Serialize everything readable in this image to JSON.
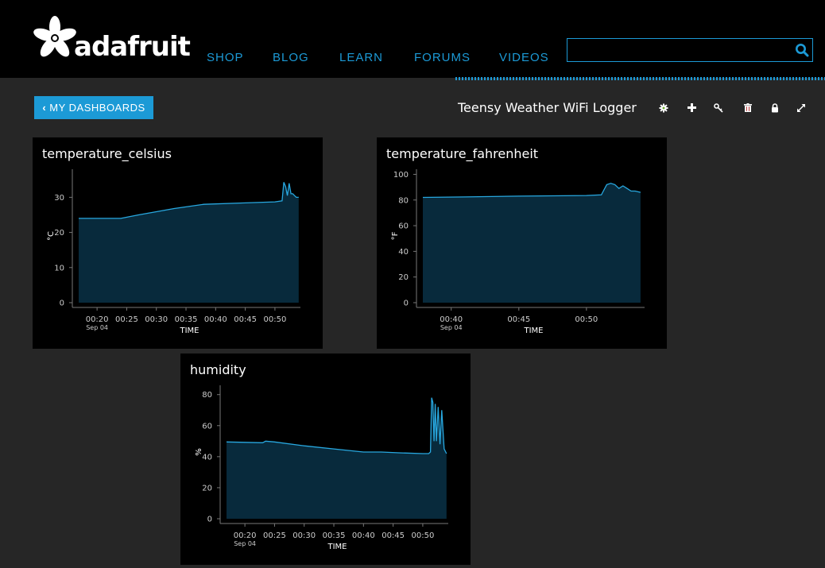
{
  "brand": {
    "name": "adafruit"
  },
  "nav": [
    "SHOP",
    "BLOG",
    "LEARN",
    "FORUMS",
    "VIDEOS"
  ],
  "search": {
    "value": "",
    "placeholder": ""
  },
  "dashboard": {
    "back_label": "MY DASHBOARDS",
    "title": "Teensy Weather WiFi Logger",
    "toolbar": [
      {
        "icon": "gear-icon",
        "color": "#6aad2c"
      },
      {
        "icon": "plus-icon",
        "color": "#1c9ad6"
      },
      {
        "icon": "key-icon",
        "color": "#a5a73c"
      },
      {
        "icon": "trash-icon",
        "color": "#b6393a"
      },
      {
        "icon": "lock-icon",
        "color": "#555555"
      },
      {
        "icon": "expand-icon",
        "color": "#555555"
      }
    ]
  },
  "colors": {
    "accent": "#1c9ad6",
    "line": "#28a8e0",
    "fill": "#082a3c"
  },
  "chart_data": [
    {
      "type": "area",
      "title": "temperature_celsius",
      "xlabel": "TIME",
      "ylabel": "°C",
      "date_label": "Sep 04",
      "ylim": [
        0,
        38
      ],
      "yticks": [
        0,
        10,
        20,
        30
      ],
      "xlim": [
        16.9,
        54.3
      ],
      "xticks": [
        20,
        25,
        30,
        35,
        40,
        45,
        50
      ],
      "xtick_labels": [
        "00:20",
        "00:25",
        "00:30",
        "00:35",
        "00:40",
        "00:45",
        "00:50"
      ],
      "x": [
        16.9,
        24.0,
        27.0,
        33.0,
        38.0,
        45.0,
        50.0,
        51.2,
        51.5,
        51.8,
        52.1,
        52.4,
        52.7,
        53.0,
        53.3,
        53.6,
        54.0
      ],
      "y": [
        24,
        24,
        25,
        26.8,
        28,
        28.4,
        28.7,
        29,
        34.3,
        33,
        30.5,
        34,
        31,
        31,
        30.5,
        30,
        30
      ]
    },
    {
      "type": "area",
      "title": "temperature_fahrenheit",
      "xlabel": "TIME",
      "ylabel": "°F",
      "date_label": "Sep 04",
      "ylim": [
        0,
        104
      ],
      "yticks": [
        0,
        20,
        40,
        60,
        80,
        100
      ],
      "xlim": [
        37.9,
        54.3
      ],
      "xticks": [
        40,
        45,
        50
      ],
      "xtick_labels": [
        "00:40",
        "00:45",
        "00:50"
      ],
      "x": [
        37.9,
        41.0,
        45.0,
        50.0,
        51.1,
        51.5,
        51.8,
        52.1,
        52.4,
        52.7,
        53.0,
        53.3,
        53.6,
        54.0
      ],
      "y": [
        82,
        82.4,
        83,
        83.5,
        84,
        92,
        93,
        92,
        89,
        91,
        89,
        87,
        87,
        86
      ]
    },
    {
      "type": "area",
      "title": "humidity",
      "xlabel": "TIME",
      "ylabel": "%",
      "date_label": "Sep 04",
      "ylim": [
        0,
        86
      ],
      "yticks": [
        0,
        20,
        40,
        60,
        80
      ],
      "xlim": [
        16.9,
        54.3
      ],
      "xticks": [
        20,
        25,
        30,
        35,
        40,
        45,
        50
      ],
      "xtick_labels": [
        "00:20",
        "00:25",
        "00:30",
        "00:35",
        "00:40",
        "00:45",
        "00:50"
      ],
      "x": [
        16.9,
        23.0,
        23.5,
        25.0,
        30.0,
        35.0,
        40.0,
        43.0,
        46.0,
        50.0,
        51.0,
        51.3,
        51.5,
        51.7,
        51.9,
        52.1,
        52.3,
        52.6,
        52.9,
        53.2,
        53.6,
        54.0
      ],
      "y": [
        49.5,
        49,
        50,
        49.5,
        47,
        45,
        43,
        43,
        42.5,
        42,
        42,
        43,
        78,
        75,
        50,
        74,
        50,
        72,
        48,
        70,
        45,
        42
      ]
    }
  ]
}
